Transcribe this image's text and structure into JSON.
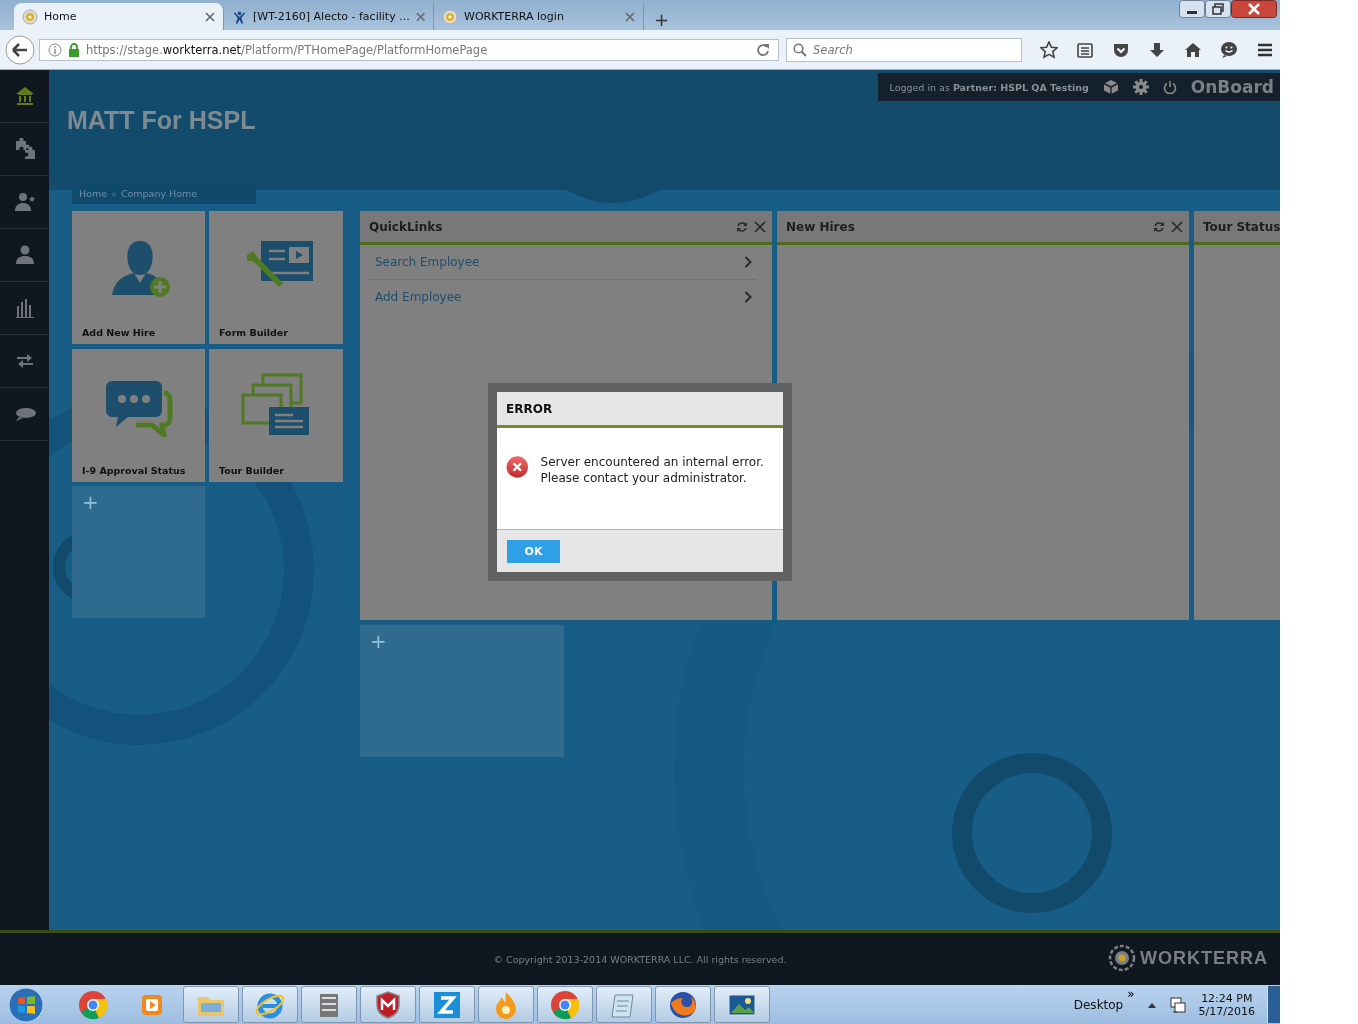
{
  "browser": {
    "tabs": [
      {
        "title": "Home",
        "selected": true,
        "kind": "site"
      },
      {
        "title": "[WT-2160] Alecto - facility ...",
        "selected": false,
        "kind": "tracker"
      },
      {
        "title": "WORKTERRA login",
        "selected": false,
        "kind": "site"
      }
    ],
    "new_tab": "+",
    "url": {
      "prefix": "https://stage.",
      "domain": "workterra.net",
      "path": "/Platform/PTHomePage/PlatformHomePage"
    },
    "search": {
      "placeholder": "Search"
    }
  },
  "topbar": {
    "logged_in": "Logged in as",
    "partner_label": "Partner:",
    "partner": "HSPL QA Testing",
    "app": "OnBoard"
  },
  "sidebar": {
    "items": [
      {
        "kind": "home",
        "selected": true
      },
      {
        "kind": "puzzle",
        "selected": false
      },
      {
        "kind": "person-star",
        "selected": false
      },
      {
        "kind": "person",
        "selected": false
      },
      {
        "kind": "chart",
        "selected": false
      },
      {
        "kind": "arrows",
        "selected": false
      },
      {
        "kind": "chat",
        "selected": false
      }
    ]
  },
  "page": {
    "title": "MATT For HSPL",
    "breadcrumb": [
      "Home",
      "Company Home"
    ],
    "breadcrumb_separator": "»"
  },
  "tiles": [
    {
      "label": "Add New Hire",
      "kind": "add-person"
    },
    {
      "label": "Form Builder",
      "kind": "form"
    },
    {
      "label": "I-9 Approval Status",
      "kind": "chat"
    },
    {
      "label": "Tour Builder",
      "kind": "tour"
    }
  ],
  "add_tile": "+",
  "widgets": [
    {
      "title": "QuickLinks",
      "controls": true,
      "links": [
        "Search Employee",
        "Add Employee"
      ]
    },
    {
      "title": "New Hires",
      "controls": true
    },
    {
      "title": "Tour Status"
    }
  ],
  "add_widget": "+",
  "dialog": {
    "title": "ERROR",
    "message": "Server encountered an internal error. Please contact your administrator.",
    "button": "OK"
  },
  "footer": {
    "copyright": "© Copyright 2013-2014 WORKTERRA LLC. All rights reserved.",
    "brand": "WORKTERRA"
  },
  "taskbar": {
    "apps": [
      {
        "kind": "chrome",
        "running": false
      },
      {
        "kind": "media",
        "running": false
      },
      {
        "kind": "folder",
        "running": true
      },
      {
        "kind": "ie",
        "running": true
      },
      {
        "kind": "cabinet",
        "running": true
      },
      {
        "kind": "shield",
        "running": true
      },
      {
        "kind": "z",
        "running": true
      },
      {
        "kind": "flame",
        "running": true
      },
      {
        "kind": "chrome",
        "running": true
      },
      {
        "kind": "note",
        "running": true
      },
      {
        "kind": "firefox",
        "running": true
      },
      {
        "kind": "photo",
        "running": true
      }
    ],
    "desktop": "Desktop",
    "chevron": "»",
    "time": "12:24 PM",
    "date": "5/17/2016"
  }
}
